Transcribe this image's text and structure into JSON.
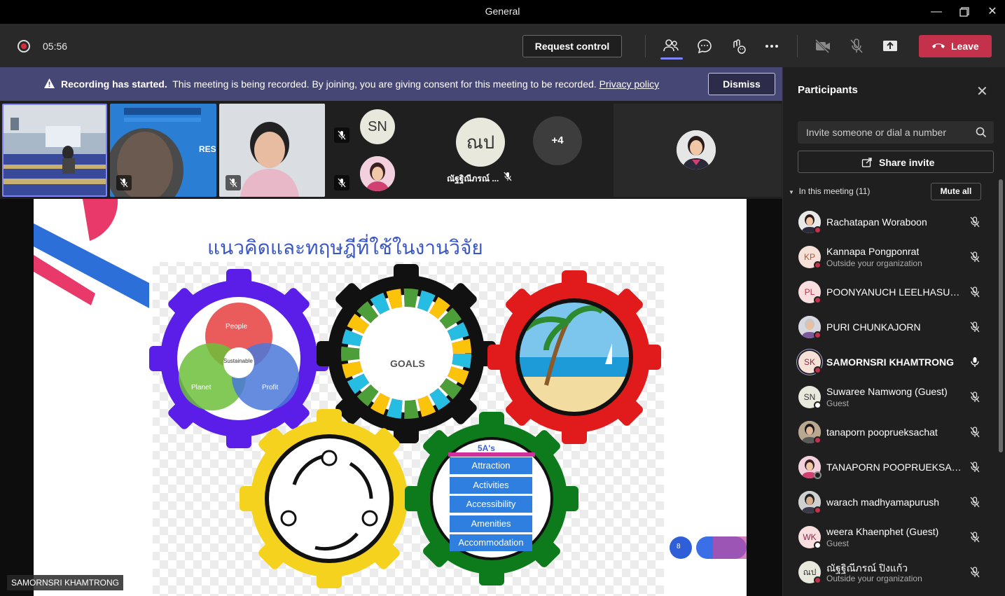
{
  "window": {
    "title": "General"
  },
  "toolbar": {
    "timer": "05:56",
    "request_control_label": "Request control",
    "leave_label": "Leave"
  },
  "banner": {
    "bold_text": "Recording has started.",
    "message": "This meeting is being recorded. By joining, you are giving consent for this meeting to be recorded.",
    "link_text": "Privacy policy",
    "dismiss_label": "Dismiss"
  },
  "gallery": {
    "tile2_text": "RES",
    "sn_initials": "SN",
    "thai_initials": "ณป",
    "thai_name": "ณัฐฐิณีภรณ์ ...",
    "overflow_count": "+4"
  },
  "slide": {
    "title": "แนวคิดและทฤษฎีที่ใช้ในงานวิจัย",
    "venn_people": "People",
    "venn_planet": "Planet",
    "venn_profit": "Profit",
    "venn_sustainable": "Sustainable",
    "sdg_text": "GOALS",
    "fivea_title": "5A's",
    "fivea_items": [
      "Attraction",
      "Activities",
      "Accessibility",
      "Amenities",
      "Accommodation"
    ],
    "page_number": "8"
  },
  "stage": {
    "speaker_name": "SAMORNSRI KHAMTRONG"
  },
  "panel": {
    "title": "Participants",
    "search_placeholder": "Invite someone or dial a number",
    "share_invite_label": "Share invite",
    "section_label": "In this meeting (11)",
    "mute_all_label": "Mute all",
    "participants": [
      {
        "name": "Rachatapan Woraboon",
        "sub": "",
        "initials": "",
        "mic": "muted",
        "status": "busy"
      },
      {
        "name": "Kannapa Pongponrat",
        "sub": "Outside your organization",
        "initials": "KP",
        "mic": "muted",
        "status": "busy"
      },
      {
        "name": "POONYANUCH LEELHASUWAN",
        "sub": "",
        "initials": "PL",
        "mic": "muted",
        "status": "busy"
      },
      {
        "name": "PURI CHUNKAJORN",
        "sub": "",
        "initials": "",
        "mic": "muted",
        "status": "busy"
      },
      {
        "name": "SAMORNSRI KHAMTRONG",
        "sub": "",
        "initials": "SK",
        "mic": "on",
        "status": "busy"
      },
      {
        "name": "Suwaree Namwong (Guest)",
        "sub": "Guest",
        "initials": "SN",
        "mic": "muted",
        "status": "offline"
      },
      {
        "name": "tanaporn pooprueksachat",
        "sub": "",
        "initials": "",
        "mic": "muted",
        "status": "busy"
      },
      {
        "name": "TANAPORN POOPRUEKSACHAT",
        "sub": "",
        "initials": "",
        "mic": "muted",
        "status": "away"
      },
      {
        "name": "warach madhyamapurush",
        "sub": "",
        "initials": "",
        "mic": "muted",
        "status": "busy"
      },
      {
        "name": "weera Khaenphet (Guest)",
        "sub": "Guest",
        "initials": "WK",
        "mic": "muted",
        "status": "offline"
      },
      {
        "name": "ณัฐฐิณีภรณ์ ปิงแก้ว",
        "sub": "Outside your organization",
        "initials": "ณป",
        "mic": "muted",
        "status": "busy"
      }
    ]
  },
  "colors": {
    "accent": "#7f85f5",
    "leave": "#c4314b",
    "banner": "#464775",
    "busy": "#c4314b",
    "offline": "#ffffff"
  }
}
